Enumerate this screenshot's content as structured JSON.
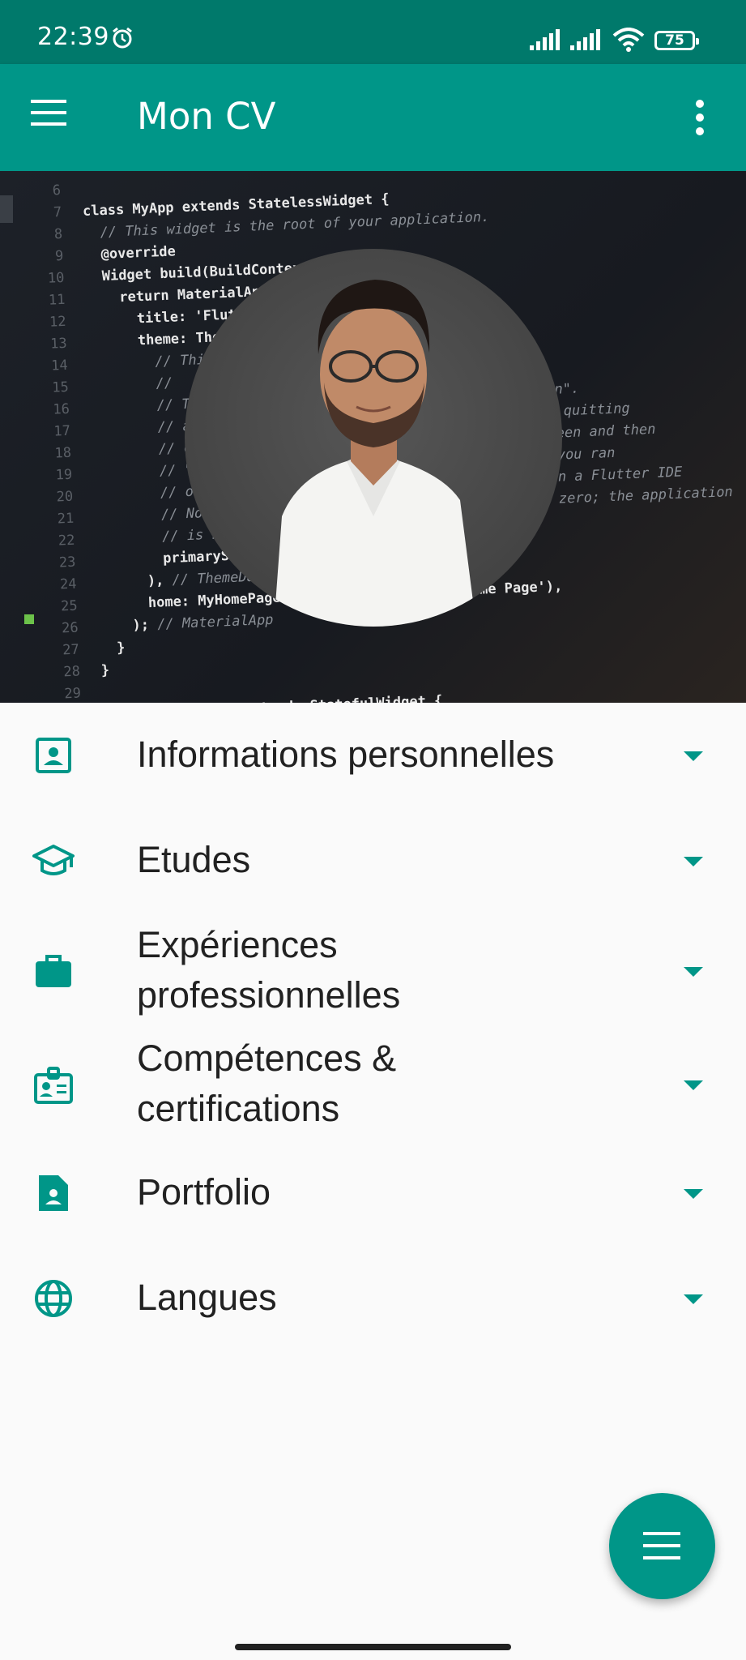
{
  "status_bar": {
    "time": "22:39",
    "battery": "75",
    "icons": [
      "alarm-icon",
      "signal-icon",
      "signal-icon",
      "wifi-icon",
      "battery-icon"
    ]
  },
  "app_bar": {
    "title": "Mon CV",
    "menu_icon": "hamburger-menu-icon",
    "overflow_icon": "more-vert-icon"
  },
  "header": {
    "background": "code-editor-image",
    "avatar": "profile-photo"
  },
  "menu_items": [
    {
      "label": "Informations personnelles",
      "icon": "contact-card-icon"
    },
    {
      "label": "Etudes",
      "icon": "graduation-cap-icon"
    },
    {
      "label_line1": "Expériences",
      "label_line2": "professionnelles",
      "icon": "briefcase-icon"
    },
    {
      "label_line1": "Compétences &",
      "label_line2": "certifications",
      "icon": "badge-icon"
    },
    {
      "label": "Portfolio",
      "icon": "account-document-icon"
    },
    {
      "label": "Langues",
      "icon": "globe-icon"
    }
  ],
  "fab": {
    "icon": "menu-icon"
  },
  "colors": {
    "primary": "#009688",
    "primary_dark": "#00796b",
    "background": "#fafafa",
    "text": "#212121"
  }
}
